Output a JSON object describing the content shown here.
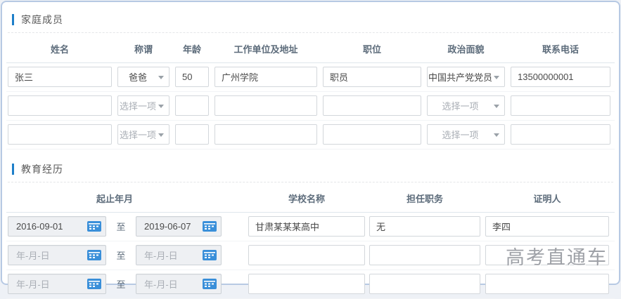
{
  "page": {
    "watermark": "高考直通车"
  },
  "colors": {
    "accent_blue": "#1e7fc9",
    "panel_border_blue": "#b7c9e3",
    "calendar_icon_blue": "#3a8fd9",
    "header_text": "#5d6c7b",
    "placeholder_gray": "#a9aeb5"
  },
  "icons": {
    "calendar": "calendar-icon",
    "dropdown_arrow": "chevron-down-icon"
  },
  "family_section": {
    "title": "家庭成员",
    "columns": [
      "姓名",
      "称谓",
      "年龄",
      "工作单位及地址",
      "职位",
      "政治面貌",
      "联系电话"
    ],
    "select_placeholder": "选择一项",
    "rows": [
      {
        "name": "张三",
        "relation": "爸爸",
        "age": "50",
        "work": "广州学院",
        "position": "职员",
        "political": "中国共产党党员",
        "phone": "13500000001"
      },
      {
        "name": "",
        "relation": "",
        "age": "",
        "work": "",
        "position": "",
        "political": "",
        "phone": ""
      },
      {
        "name": "",
        "relation": "",
        "age": "",
        "work": "",
        "position": "",
        "political": "",
        "phone": ""
      }
    ]
  },
  "education_section": {
    "title": "教育经历",
    "columns": [
      "起止年月",
      "学校名称",
      "担任职务",
      "证明人"
    ],
    "to_label": "至",
    "date_placeholder": "年-月-日",
    "rows": [
      {
        "start": "2016-09-01",
        "end": "2019-06-07",
        "school": "甘肃某某某高中",
        "position": "无",
        "reference": "李四"
      },
      {
        "start": "",
        "end": "",
        "school": "",
        "position": "",
        "reference": ""
      },
      {
        "start": "",
        "end": "",
        "school": "",
        "position": "",
        "reference": ""
      }
    ]
  }
}
